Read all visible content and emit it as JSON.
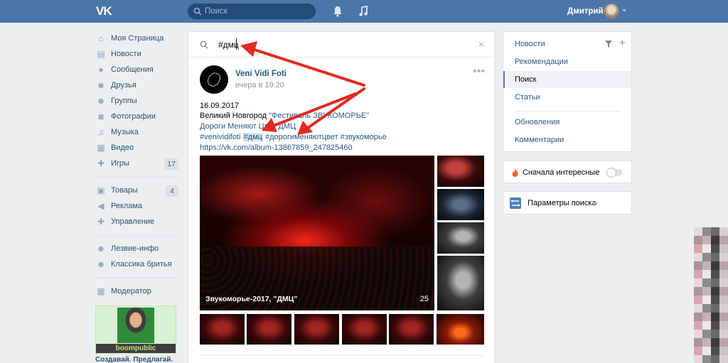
{
  "header": {
    "logo": "VK",
    "search_placeholder": "Поиск",
    "user_name": "Дмитрий"
  },
  "sidebar": {
    "items": [
      {
        "label": "Моя Страница",
        "icon": "home-icon",
        "glyph": "⌂"
      },
      {
        "label": "Новости",
        "icon": "news-icon",
        "glyph": "▤"
      },
      {
        "label": "Сообщения",
        "icon": "messages-icon",
        "glyph": "●"
      },
      {
        "label": "Друзья",
        "icon": "friends-icon",
        "glyph": "☻"
      },
      {
        "label": "Группы",
        "icon": "groups-icon",
        "glyph": "☻"
      },
      {
        "label": "Фотографии",
        "icon": "camera-icon",
        "glyph": "◙"
      },
      {
        "label": "Музыка",
        "icon": "music-note-icon",
        "glyph": "♫"
      },
      {
        "label": "Видео",
        "icon": "video-icon",
        "glyph": "▦"
      },
      {
        "label": "Игры",
        "icon": "gamepad-icon",
        "glyph": "✚",
        "badge": "17"
      }
    ],
    "items2": [
      {
        "label": "Товары",
        "icon": "shopping-bag-icon",
        "glyph": "▣",
        "badge": "4"
      },
      {
        "label": "Реклама",
        "icon": "megaphone-icon",
        "glyph": "◀"
      },
      {
        "label": "Управление",
        "icon": "gamepad-icon",
        "glyph": "✚"
      }
    ],
    "items3": [
      {
        "label": "Лезвие-инфо",
        "icon": "community-icon",
        "glyph": "☻"
      },
      {
        "label": "Классика бритья",
        "icon": "community-icon",
        "glyph": "☻"
      }
    ],
    "items4": [
      {
        "label": "Модератор",
        "icon": "apps-icon",
        "glyph": "▦"
      }
    ],
    "ad": {
      "brand": "boompublic",
      "text": "Создавай. Предлагай."
    }
  },
  "search": {
    "value": "#дмц"
  },
  "post": {
    "author": "Veni Vidi Foti",
    "time": "вчера в 19:20",
    "date_line": "16.09.2017",
    "line2_prefix": "Великий Новгород ",
    "line2_link": "\"Фестиваль ЗВУКОМОРЬЕ\"",
    "line3_link": "Дороги Меняют Цвет ДМЦ",
    "tag1": "#venividifoti",
    "tag2": "#дмц",
    "tag3": "#дорогименяютцвет",
    "tag4": "#звукоморье",
    "url": "https://vk.com/album-13867859_247825460",
    "album_title": "Звукоморье-2017, \"ДМЦ\"",
    "album_count": "25"
  },
  "right_menu": {
    "items": [
      "Новости",
      "Рекомендации",
      "Поиск",
      "Статьи",
      "Обновления",
      "Комментарии"
    ],
    "active": "Поиск"
  },
  "interesting": {
    "label": "Сначала интересные",
    "enabled": false
  },
  "params": {
    "label": "Параметры поиска"
  },
  "colors": {
    "header": "#4a76a8",
    "link": "#2a5885",
    "arrow": "#e02a22"
  }
}
